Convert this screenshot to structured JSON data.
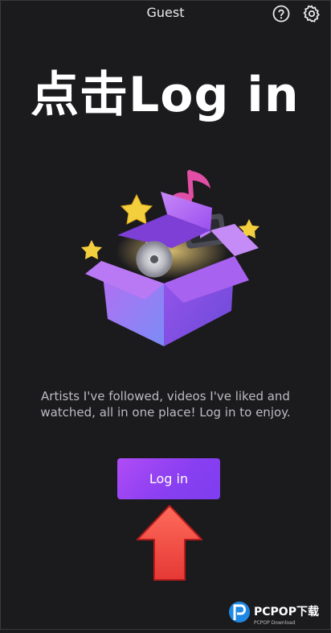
{
  "header": {
    "title": "Guest",
    "help_icon": "help-circle-icon",
    "settings_icon": "gear-icon"
  },
  "overlay": {
    "caption": "点击Log in"
  },
  "hero": {
    "illustration": "gift-box-illustration"
  },
  "content": {
    "description": "Artists I've followed, videos I've liked and watched, all in one place! Log in to enjoy."
  },
  "actions": {
    "login_label": "Log in"
  },
  "annotation": {
    "arrow_color": "#e53935"
  },
  "watermark": {
    "brand": "PCPOP下载",
    "sub": "PCPOP Download"
  },
  "colors": {
    "background": "#1b1a1d",
    "accent": "#9b45f3"
  }
}
